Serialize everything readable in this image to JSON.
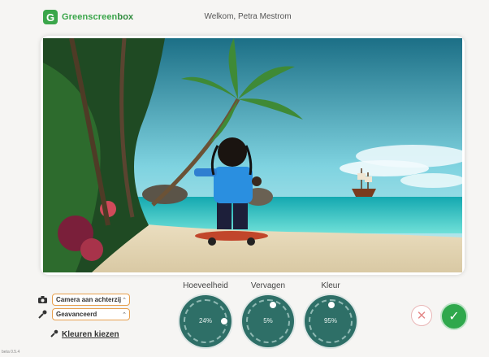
{
  "header": {
    "logo_letter": "G",
    "logo_text_a": "Greenscreen",
    "logo_text_b": "box",
    "welcome": "Welkom, Petra Mestrom"
  },
  "controls": {
    "camera_select": "Camera aan achterzij",
    "mode_select": "Geavanceerd",
    "colors_link": "Kleuren kiezen"
  },
  "dials": [
    {
      "label": "Hoeveelheid",
      "value": "24%"
    },
    {
      "label": "Vervagen",
      "value": "5%"
    },
    {
      "label": "Kleur",
      "value": "95%"
    }
  ],
  "version": "beta 0.5.4",
  "colors": {
    "brand": "#3aa64a",
    "dial": "#2e6f67",
    "select_border": "#e7a04e",
    "confirm": "#2fa84c",
    "cancel": "#e48a8a"
  }
}
